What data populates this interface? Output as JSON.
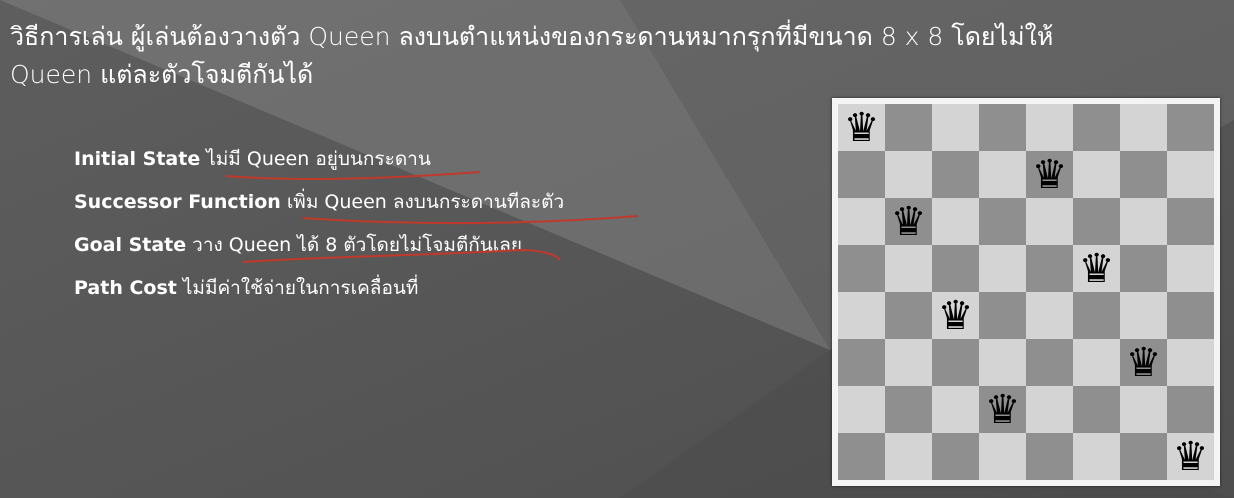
{
  "slide": {
    "heading_line1": "วิธีการเล่น ผู้เล่นต้องวางตัว Queen ลงบนตำแหน่งของกระดานหมากรุกที่มีขนาด 8 x 8 โดยไม่ให้",
    "heading_line2": "Queen แต่ละตัวโจมตีกันได้",
    "bullets": [
      {
        "term": "Initial State",
        "text": "ไม่มี Queen อยู่บนกระดาน"
      },
      {
        "term": "Successor Function",
        "text": "เพิ่ม Queen ลงบนกระดานทีละตัว"
      },
      {
        "term": "Goal State",
        "text": "วาง Queen ได้ 8 ตัวโดยไม่โจมตีกันเลย"
      },
      {
        "term": "Path Cost",
        "text": "ไม่มีค่าใช้จ่ายในการเคลื่อนที่"
      }
    ]
  },
  "board": {
    "size": 8,
    "queen_symbol": "♛",
    "queen_columns_by_row": [
      0,
      4,
      1,
      5,
      2,
      6,
      3,
      7
    ]
  },
  "colors": {
    "background": "#5a5a5a",
    "text": "#ffffff",
    "annotation": "#c0392b",
    "light_square": "#d4d4d4",
    "dark_square": "#8f8f8f"
  },
  "icons": {
    "queen": "chess-queen-icon"
  }
}
